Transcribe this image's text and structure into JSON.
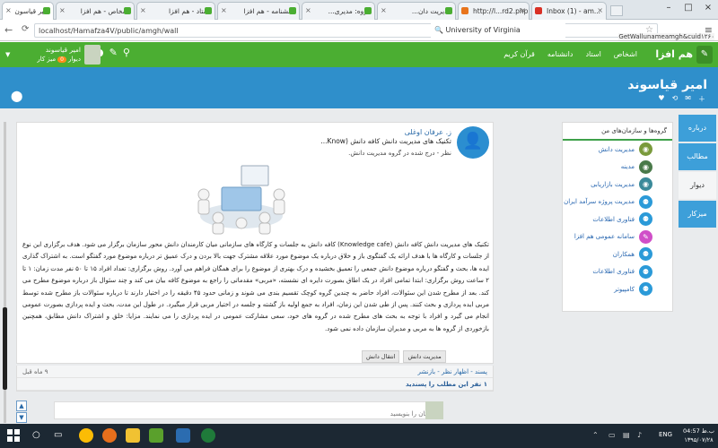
{
  "browser": {
    "tabs": [
      {
        "label": "امیر قیاسون",
        "color": "#4bae32"
      },
      {
        "label": "اشخاص - هم افزا",
        "color": "#4bae32"
      },
      {
        "label": "استاد - هم افزا",
        "color": "#4bae32"
      },
      {
        "label": "دانشنامه - هم افزا",
        "color": "#4bae32"
      },
      {
        "label": "گروه: مدیری...",
        "color": "#4bae32"
      },
      {
        "label": "مدیریت دان...",
        "color": "#4bae32"
      },
      {
        "label": "http://l...rd2.php",
        "color": "#e8741c"
      },
      {
        "label": "Inbox (1) - am...",
        "color": "#d93025"
      }
    ],
    "url": "localhost/Hamafza4V/public/amgh/wall",
    "search_text": "University of Virginia",
    "status_url": "GetWallunameamgh&cuid۱۲۶۰"
  },
  "header": {
    "brand": "هم افزا",
    "nav": [
      "قرآن کریم",
      "دانشنامه",
      "استاد",
      "اشخاص"
    ],
    "user_name": "امیر قیاسوند",
    "desk_label": "دیوار",
    "badge": "0",
    "workspace": "میز کار"
  },
  "profile": {
    "title": "امیر قیاسوند"
  },
  "side_tabs": [
    "درباره",
    "مطالب",
    "دیوار",
    "میزکار"
  ],
  "orgs": {
    "heading": "گروه‌ها و سازمان‌های من",
    "items": [
      "مدیریت دانش",
      "مدینه",
      "مدیریت بازاریابی",
      "مدیریت پروژه سرآمد ایران",
      "فناوری اطلاعات",
      "سامانه عمومی هم افزا",
      "همکاران",
      "فناوری اطلاعات",
      "کامپیوتر"
    ]
  },
  "post": {
    "author": "ز. عرفان اوغلی",
    "title": "تکنیک های مدیریت دانش کافه دانش (Know...",
    "note": "نظر - درج شده در گروه مدیریت دانش.",
    "body": "تکنیک های مدیریت دانش کافه دانش (Knowledge cafe) کافه دانش به جلسات و کارگاه های سازمانی میان کارمندان دانش محور سازمان برگزار می شود. هدف برگزاری این نوع از جلسات و کارگاه ها با هدف ارائه یک گفتگوی باز و خلاق درباره یک موضوع مورد علاقه مشترک جهت بالا بردن و درک عمیق تر درباره موضوع مورد گفتگو است. به اشتراک گذاری ایده ها، بحث و گفتگو درباره موضوع دانش جمعی را تعمیق بخشیده و درک بهتری از موضوع را برای همگان فراهم می آورد. روش برگزاری: تعداد افراد ۱۵ تا ۵۰ نفر مدت زمان: ۱ تا ۲ ساعت روش برگزاری: ابتدا تمامی افراد در یک اطاق بصورت دایره ای نشسته، «مربی» مقدماتی را راجع به موضوع کافه بیان می کند و چند سئوال باز درباره موضوع مطرح می کند. بعد از مطرح شدن این سئوالات، افراد حاضر به چندین گروه کوچک تقسیم بندی می شوند و زمانی حدود ۴۵ دقیقه را در اختیار دارند تا درباره سئوالات باز مطرح شده توسط مربی ایده پردازی و بحث کنند. پس از طی شدن این زمان، افراد به جمع اولیه باز گشته و جلسه در اختیار مربی قرار میگیرد. در طول این مدت، بحث و ایده پردازی بصورت عمومی انجام می گیرد و افراد با توجه به بحث های مطرح شده در گروه های خود، سعی مشارکت عمومی در ایده پردازی را می نمایند. مزایا: خلق و اشتراک دانش مطابق، همچنین بازخوردی از گروه ها به مربی و مدیران سازمان داده نمی شود.",
    "tags": [
      "مدیریت دانش",
      "انتقال دانش"
    ],
    "date": "۹ ماه قبل",
    "actions": "پسند - اظهار نظر - بازنشر",
    "likes": "۱ نفر این مطلب را پسندید",
    "comment_placeholder": "نظرتان را بنویسید"
  },
  "taskbar": {
    "time": "04:57 ب.ظ",
    "date": "۱۳۹۵/۰۷/۲۸",
    "lang": "ENG"
  }
}
